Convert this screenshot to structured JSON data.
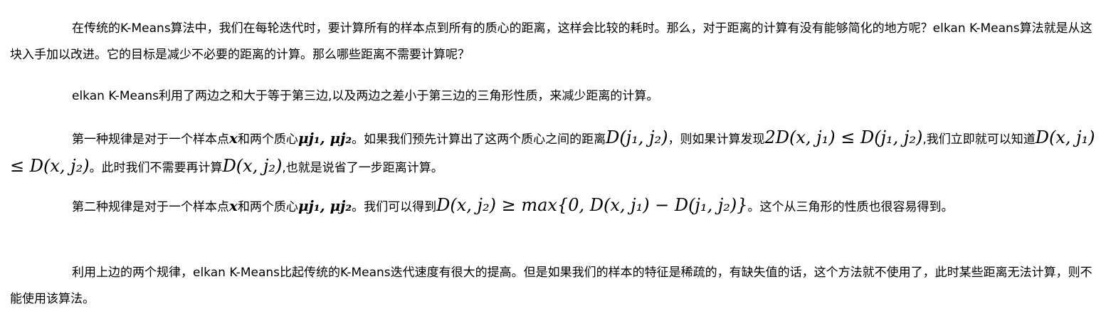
{
  "paragraphs": {
    "p1": "在传统的K-Means算法中，我们在每轮迭代时，要计算所有的样本点到所有的质心的距离，这样会比较的耗时。那么，对于距离的计算有没有能够简化的地方呢？elkan K-Means算法就是从这块入手加以改进。它的目标是减少不必要的距离的计算。那么哪些距离不需要计算呢？",
    "p2": "elkan K-Means利用了两边之和大于等于第三边,以及两边之差小于第三边的三角形性质，来减少距离的计算。",
    "p3": {
      "t1": "第一种规律是对于一个样本点",
      "m1": "x",
      "t2": "和两个质心",
      "m2": "μj₁, μj₂",
      "t3": "。如果我们预先计算出了这两个质心之间的距离",
      "m3": "D(j₁, j₂)",
      "t4": "，则如果计算发现",
      "m4": "2D(x, j₁) ≤ D(j₁, j₂)",
      "t5": ",我们立即就可以知道",
      "m5": "D(x, j₁) ≤ D(x, j₂)",
      "t6": "。此时我们不需要再计算",
      "m6": "D(x, j₂)",
      "t7": ",也就是说省了一步距离计算。"
    },
    "p4": {
      "t1": "第二种规律是对于一个样本点",
      "m1": "x",
      "t2": "和两个质心",
      "m2": "μj₁, μj₂",
      "t3": "。我们可以得到",
      "m3": "D(x, j₂) ≥ max{0, D(x, j₁) − D(j₁, j₂)}",
      "t4": "。这个从三角形的性质也很容易得到。"
    },
    "p5": "利用上边的两个规律，elkan K-Means比起传统的K-Means迭代速度有很大的提高。但是如果我们的样本的特征是稀疏的，有缺失值的话，这个方法就不使用了，此时某些距离无法计算，则不能使用该算法。"
  }
}
